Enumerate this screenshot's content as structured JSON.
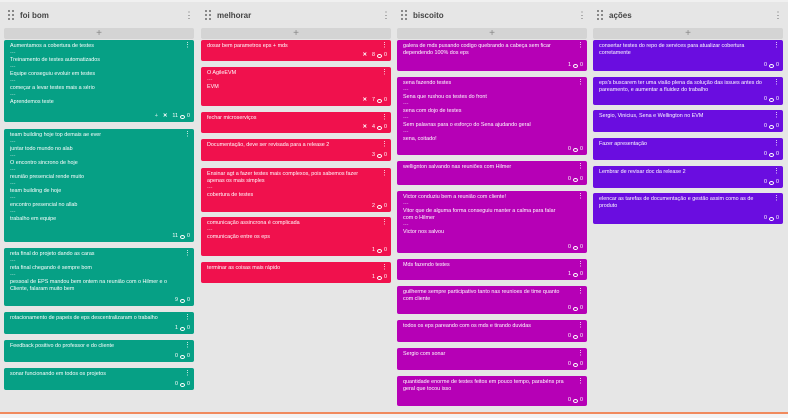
{
  "columns": [
    {
      "title": "foi bom",
      "color": "#06a085",
      "cards": [
        {
          "lines": [
            "Aumentamos a cobertura de testes",
            "---",
            "Treinamento de testes automatizados",
            "---",
            "Equipe conseguiu evoluir em testes",
            "---",
            "começar a levar testes mais a sério",
            "---",
            "Aprendemos teste"
          ],
          "votes": "11",
          "comments": "0",
          "close": true,
          "extra": "+"
        },
        {
          "lines": [
            "team building hoje top demais ae ever",
            "---",
            "juntar todo mundo no alab",
            "---",
            "O encontro sincrono de hoje",
            "---",
            "reunião presencial rende muito",
            "---",
            "team building de hoje",
            "---",
            "encontro presencial no allab",
            "---",
            "trabalho em equipe"
          ],
          "votes": "11",
          "comments": "0"
        },
        {
          "lines": [
            "reta final do projeto dando as caras",
            "---",
            "reta final chegando é sempre bom",
            "---",
            "pessoal de EPS mandou bem ontem na reunião com o Hilmer e o",
            "Cliente, falaram muito bem"
          ],
          "votes": "9",
          "comments": "0"
        },
        {
          "lines": [
            "rotacionamento de papeis de eps descentralizaram o trabalho"
          ],
          "votes": "1",
          "comments": "0"
        },
        {
          "lines": [
            "Feedback positivo do professor e do cliente"
          ],
          "votes": "0",
          "comments": "0"
        },
        {
          "lines": [
            "sonar funcionando em todos os projetos"
          ],
          "votes": "0",
          "comments": "0"
        }
      ]
    },
    {
      "title": "melhorar",
      "color": "#f0114d",
      "cards": [
        {
          "lines": [
            "dosar bem parametros eps + mds"
          ],
          "votes": "8",
          "comments": "0",
          "close": true
        },
        {
          "lines": [
            "O AgileEVM",
            "---",
            "EVM"
          ],
          "votes": "7",
          "comments": "0",
          "close": true
        },
        {
          "lines": [
            "fechar microserviços"
          ],
          "votes": "4",
          "comments": "0",
          "close": true
        },
        {
          "lines": [
            "Documentação, deve ser revisada para a release 2"
          ],
          "votes": "3",
          "comments": "0"
        },
        {
          "lines": [
            "Ensinar agt a fazer testes mais complexos, pois sabemos fazer",
            "apenas os mais simples",
            "---",
            "cobertura de testes"
          ],
          "votes": "2",
          "comments": "0"
        },
        {
          "lines": [
            "comunicação assincrona é complicada",
            "---",
            "comunicação entre os eps"
          ],
          "votes": "1",
          "comments": "0"
        },
        {
          "lines": [
            "terminar as coisas mais rápido"
          ],
          "votes": "1",
          "comments": "0"
        }
      ]
    },
    {
      "title": "biscoito",
      "color": "#b600b6",
      "cards": [
        {
          "lines": [
            "galera de mds puxando codigo quebrando a cabeça sem ficar",
            "dependendo 100% dos eps"
          ],
          "votes": "1",
          "comments": "0"
        },
        {
          "lines": [
            "sena fazendo testes",
            "---",
            "Sena que rushou os testes do front",
            "---",
            "sena com dojo de testes",
            "---",
            "Sem palavras para o esforço do Sena ajudando geral",
            "---",
            "sena, coitado!"
          ],
          "votes": "0",
          "comments": "0"
        },
        {
          "lines": [
            "wellignton salvando nas reuniões com Hilmer"
          ],
          "votes": "0",
          "comments": "0"
        },
        {
          "lines": [
            "Victor conduziu bem a reunião com cliente!",
            "---",
            "Vitor que de alguma forma conseguiu manter a calma para falar",
            "com o Hilmer",
            "---",
            "Victor nos salvou"
          ],
          "votes": "0",
          "comments": "0"
        },
        {
          "lines": [
            "Mds fazendo testes"
          ],
          "votes": "1",
          "comments": "0"
        },
        {
          "lines": [
            "guilherme sempre participativo tanto nas reunioes de time quanto",
            "com cliente"
          ],
          "votes": "0",
          "comments": "0"
        },
        {
          "lines": [
            "todos os eps pareando com os mds e tirando duvidas"
          ],
          "votes": "0",
          "comments": "0"
        },
        {
          "lines": [
            "Sergio com sonar"
          ],
          "votes": "0",
          "comments": "0"
        },
        {
          "lines": [
            "quantidade enorme de testes feitos em pouco tempo, parabéns pra",
            "geral que tocou isso"
          ],
          "votes": "0",
          "comments": "0"
        }
      ]
    },
    {
      "title": "ações",
      "color": "#6a0de0",
      "cards": [
        {
          "lines": [
            "consertar testes do repo de services para atualizar cobertura",
            "corretamente"
          ],
          "votes": "0",
          "comments": "0"
        },
        {
          "lines": [
            "eps's buscarem ter uma visão plena da solução das issues antes do",
            "pareamento, e aumentar a fluidez do trabalho"
          ],
          "votes": "0",
          "comments": "0"
        },
        {
          "lines": [
            "Sergio, Vinicius, Sena e Wellington no EVM"
          ],
          "votes": "0",
          "comments": "0"
        },
        {
          "lines": [
            "Fazer apresentação"
          ],
          "votes": "0",
          "comments": "0"
        },
        {
          "lines": [
            "Lembrar de revisar doc da release 2"
          ],
          "votes": "0",
          "comments": "0"
        },
        {
          "lines": [
            "elencar as tarefas de documentação e gestão assim como as de",
            "produto"
          ],
          "votes": "0",
          "comments": "0"
        }
      ]
    }
  ]
}
